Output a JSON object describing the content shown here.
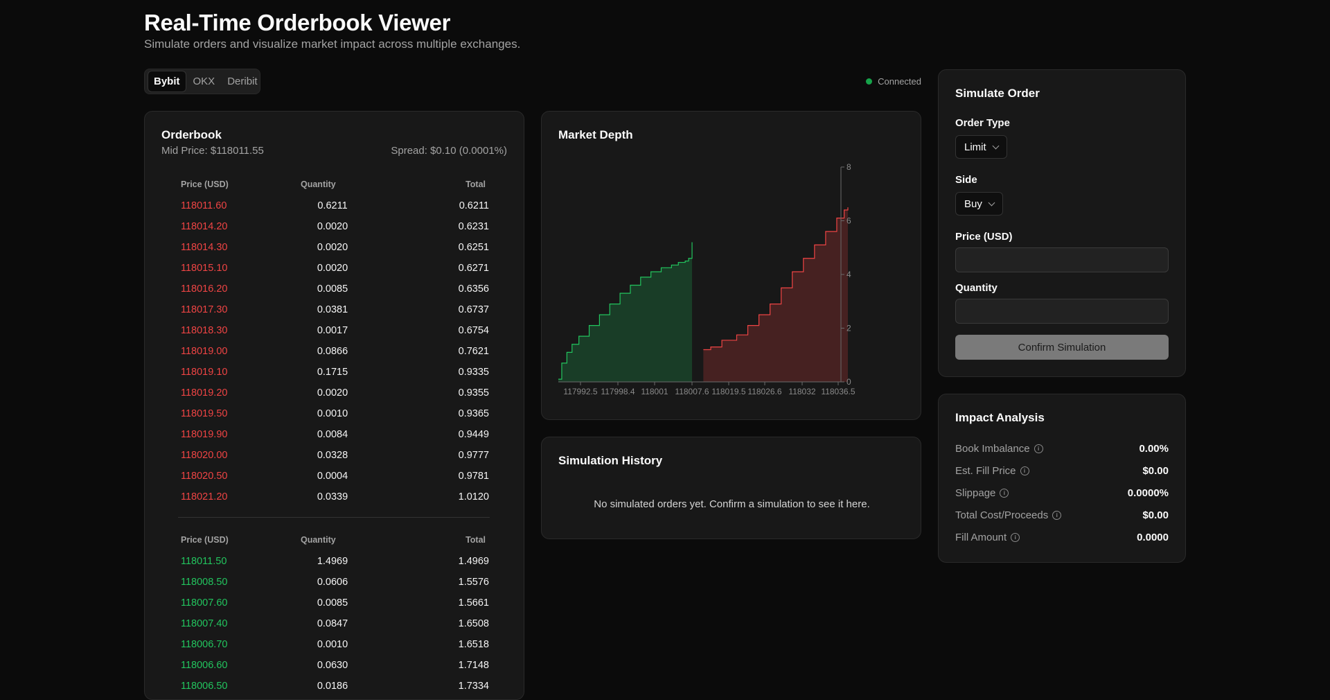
{
  "header": {
    "title": "Real-Time Orderbook Viewer",
    "subtitle": "Simulate orders and visualize market impact across multiple exchanges."
  },
  "exchanges": {
    "tabs": [
      {
        "label": "Bybit",
        "active": true
      },
      {
        "label": "OKX",
        "active": false
      },
      {
        "label": "Deribit",
        "active": false
      }
    ]
  },
  "connection": {
    "status": "Connected",
    "color": "#16a34a"
  },
  "orderbook": {
    "title": "Orderbook",
    "mid_price": "Mid Price: $118011.55",
    "spread": "Spread: $0.10 (0.0001%)",
    "columns": [
      "Price (USD)",
      "Quantity",
      "Total"
    ],
    "asks": [
      [
        "118011.60",
        "0.6211",
        "0.6211"
      ],
      [
        "118014.20",
        "0.0020",
        "0.6231"
      ],
      [
        "118014.30",
        "0.0020",
        "0.6251"
      ],
      [
        "118015.10",
        "0.0020",
        "0.6271"
      ],
      [
        "118016.20",
        "0.0085",
        "0.6356"
      ],
      [
        "118017.30",
        "0.0381",
        "0.6737"
      ],
      [
        "118018.30",
        "0.0017",
        "0.6754"
      ],
      [
        "118019.00",
        "0.0866",
        "0.7621"
      ],
      [
        "118019.10",
        "0.1715",
        "0.9335"
      ],
      [
        "118019.20",
        "0.0020",
        "0.9355"
      ],
      [
        "118019.50",
        "0.0010",
        "0.9365"
      ],
      [
        "118019.90",
        "0.0084",
        "0.9449"
      ],
      [
        "118020.00",
        "0.0328",
        "0.9777"
      ],
      [
        "118020.50",
        "0.0004",
        "0.9781"
      ],
      [
        "118021.20",
        "0.0339",
        "1.0120"
      ]
    ],
    "bids": [
      [
        "118011.50",
        "1.4969",
        "1.4969"
      ],
      [
        "118008.50",
        "0.0606",
        "1.5576"
      ],
      [
        "118007.60",
        "0.0085",
        "1.5661"
      ],
      [
        "118007.40",
        "0.0847",
        "1.6508"
      ],
      [
        "118006.70",
        "0.0010",
        "1.6518"
      ],
      [
        "118006.60",
        "0.0630",
        "1.7148"
      ],
      [
        "118006.50",
        "0.0186",
        "1.7334"
      ]
    ],
    "colors": {
      "ask": "#ef4444",
      "bid": "#22c55e"
    }
  },
  "market_depth": {
    "title": "Market Depth",
    "chart_data": {
      "type": "area",
      "x_ticks": [
        "117992.5",
        "117998.4",
        "118001",
        "118007.6",
        "118019.5",
        "118026.6",
        "118032",
        "118036.5"
      ],
      "y_ticks": [
        "0",
        "2",
        "4",
        "6",
        "8"
      ],
      "ylim": [
        0,
        8
      ],
      "series": [
        {
          "side": "bid",
          "color": "#22c55e",
          "points": [
            [
              0,
              0.1
            ],
            [
              0.02,
              0.7
            ],
            [
              0.05,
              1.1
            ],
            [
              0.08,
              1.4
            ],
            [
              0.12,
              1.7
            ],
            [
              0.18,
              2.1
            ],
            [
              0.24,
              2.5
            ],
            [
              0.3,
              2.9
            ],
            [
              0.36,
              3.3
            ],
            [
              0.42,
              3.6
            ],
            [
              0.48,
              3.9
            ],
            [
              0.54,
              4.1
            ],
            [
              0.6,
              4.25
            ],
            [
              0.66,
              4.35
            ],
            [
              0.7,
              4.45
            ],
            [
              0.74,
              4.5
            ],
            [
              0.76,
              4.6
            ],
            [
              0.78,
              5.2
            ]
          ]
        },
        {
          "side": "ask",
          "color": "#ef4444",
          "points": [
            [
              0.02,
              1.2
            ],
            [
              0.06,
              1.3
            ],
            [
              0.12,
              1.55
            ],
            [
              0.2,
              1.75
            ],
            [
              0.26,
              2.1
            ],
            [
              0.32,
              2.5
            ],
            [
              0.38,
              2.9
            ],
            [
              0.44,
              3.5
            ],
            [
              0.5,
              4.1
            ],
            [
              0.56,
              4.6
            ],
            [
              0.62,
              5.1
            ],
            [
              0.68,
              5.6
            ],
            [
              0.74,
              6.1
            ],
            [
              0.78,
              6.4
            ],
            [
              0.8,
              6.5
            ]
          ]
        }
      ]
    }
  },
  "simulation_history": {
    "title": "Simulation History",
    "empty_text": "No simulated orders yet. Confirm a simulation to see it here."
  },
  "simulate_order": {
    "title": "Simulate Order",
    "order_type_label": "Order Type",
    "order_type_value": "Limit",
    "side_label": "Side",
    "side_value": "Buy",
    "price_label": "Price (USD)",
    "price_value": "",
    "quantity_label": "Quantity",
    "quantity_value": "",
    "confirm_label": "Confirm Simulation"
  },
  "impact_analysis": {
    "title": "Impact Analysis",
    "rows": [
      {
        "label": "Book Imbalance",
        "value": "0.00%"
      },
      {
        "label": "Est. Fill Price",
        "value": "$0.00"
      },
      {
        "label": "Slippage",
        "value": "0.0000%"
      },
      {
        "label": "Total Cost/Proceeds",
        "value": "$0.00"
      },
      {
        "label": "Fill Amount",
        "value": "0.0000"
      }
    ]
  }
}
